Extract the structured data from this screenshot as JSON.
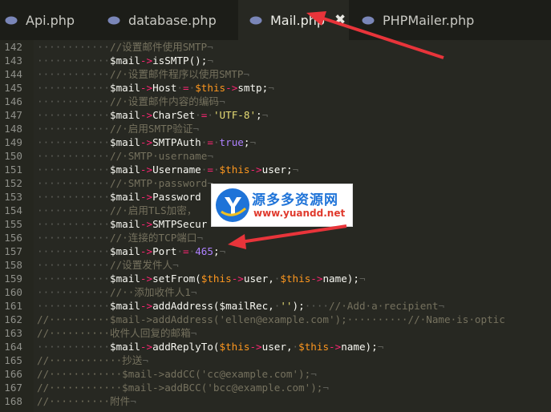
{
  "tabs": [
    {
      "label": "Api.php",
      "active": false
    },
    {
      "label": "database.php",
      "active": false
    },
    {
      "label": "Mail.php",
      "active": true
    },
    {
      "label": "PHPMailer.php",
      "active": false
    }
  ],
  "tab_close_glyph": "✖",
  "watermark": {
    "brand_cn": "源多多资源网",
    "url": "www.yuandd.net"
  },
  "colors": {
    "background": "#272822",
    "comment": "#75715e",
    "operator": "#f92672",
    "string": "#e6db74",
    "number": "#ae81ff",
    "this": "#fd971f",
    "arrow": "#e8343a"
  },
  "lines": [
    {
      "n": "142",
      "indent": "············",
      "parts": [
        [
          "cm",
          "//设置邮件使用SMTP"
        ],
        [
          "dots",
          "¬"
        ]
      ]
    },
    {
      "n": "143",
      "indent": "············",
      "parts": [
        [
          "var",
          "$mail"
        ],
        [
          "op",
          "->"
        ],
        [
          "fn",
          "isSMTP"
        ],
        [
          "var",
          "();"
        ],
        [
          "dots",
          "¬"
        ]
      ]
    },
    {
      "n": "144",
      "indent": "············",
      "parts": [
        [
          "cm",
          "//·设置邮件程序以使用SMTP"
        ],
        [
          "dots",
          "¬"
        ]
      ]
    },
    {
      "n": "145",
      "indent": "············",
      "parts": [
        [
          "var",
          "$mail"
        ],
        [
          "op",
          "->"
        ],
        [
          "prop",
          "Host"
        ],
        [
          "dots",
          "·"
        ],
        [
          "op",
          "="
        ],
        [
          "dots",
          "·"
        ],
        [
          "this",
          "$this"
        ],
        [
          "op",
          "->"
        ],
        [
          "prop",
          "smtp;"
        ],
        [
          "dots",
          "¬"
        ]
      ]
    },
    {
      "n": "146",
      "indent": "············",
      "parts": [
        [
          "cm",
          "//·设置邮件内容的编码"
        ],
        [
          "dots",
          "¬"
        ]
      ]
    },
    {
      "n": "147",
      "indent": "············",
      "parts": [
        [
          "var",
          "$mail"
        ],
        [
          "op",
          "->"
        ],
        [
          "prop",
          "CharSet"
        ],
        [
          "dots",
          "·"
        ],
        [
          "op",
          "="
        ],
        [
          "dots",
          "·"
        ],
        [
          "str",
          "'UTF-8'"
        ],
        [
          "var",
          ";"
        ],
        [
          "dots",
          "¬"
        ]
      ]
    },
    {
      "n": "148",
      "indent": "············",
      "parts": [
        [
          "cm",
          "//·启用SMTP验证"
        ],
        [
          "dots",
          "¬"
        ]
      ]
    },
    {
      "n": "149",
      "indent": "············",
      "parts": [
        [
          "var",
          "$mail"
        ],
        [
          "op",
          "->"
        ],
        [
          "prop",
          "SMTPAuth"
        ],
        [
          "dots",
          "·"
        ],
        [
          "op",
          "="
        ],
        [
          "dots",
          "·"
        ],
        [
          "kw",
          "true"
        ],
        [
          "var",
          ";"
        ],
        [
          "dots",
          "¬"
        ]
      ]
    },
    {
      "n": "150",
      "indent": "············",
      "parts": [
        [
          "cm",
          "//·SMTP·username"
        ],
        [
          "dots",
          "¬"
        ]
      ]
    },
    {
      "n": "151",
      "indent": "············",
      "parts": [
        [
          "var",
          "$mail"
        ],
        [
          "op",
          "->"
        ],
        [
          "prop",
          "Username"
        ],
        [
          "dots",
          "·"
        ],
        [
          "op",
          "="
        ],
        [
          "dots",
          "·"
        ],
        [
          "this",
          "$this"
        ],
        [
          "op",
          "->"
        ],
        [
          "prop",
          "user;"
        ],
        [
          "dots",
          "¬"
        ]
      ]
    },
    {
      "n": "152",
      "indent": "············",
      "parts": [
        [
          "cm",
          "//·SMTP·password"
        ],
        [
          "dots",
          "¬"
        ]
      ]
    },
    {
      "n": "153",
      "indent": "············",
      "parts": [
        [
          "var",
          "$mail"
        ],
        [
          "op",
          "->"
        ],
        [
          "prop",
          "Password"
        ]
      ]
    },
    {
      "n": "154",
      "indent": "············",
      "parts": [
        [
          "cm",
          "//·启用TLS加密，"
        ]
      ]
    },
    {
      "n": "155",
      "indent": "············",
      "parts": [
        [
          "var",
          "$mail"
        ],
        [
          "op",
          "->"
        ],
        [
          "prop",
          "SMTPSecur"
        ]
      ]
    },
    {
      "n": "156",
      "indent": "············",
      "parts": [
        [
          "cm",
          "//·连接的TCP端口"
        ],
        [
          "dots",
          "¬"
        ]
      ]
    },
    {
      "n": "157",
      "indent": "············",
      "parts": [
        [
          "var",
          "$mail"
        ],
        [
          "op",
          "->"
        ],
        [
          "prop",
          "Port"
        ],
        [
          "dots",
          "·"
        ],
        [
          "op",
          "="
        ],
        [
          "dots",
          "·"
        ],
        [
          "num",
          "465"
        ],
        [
          "var",
          ";"
        ],
        [
          "dots",
          "¬"
        ]
      ]
    },
    {
      "n": "158",
      "indent": "············",
      "parts": [
        [
          "cm",
          "//设置发件人"
        ],
        [
          "dots",
          "¬"
        ]
      ]
    },
    {
      "n": "159",
      "indent": "············",
      "parts": [
        [
          "var",
          "$mail"
        ],
        [
          "op",
          "->"
        ],
        [
          "fn",
          "setFrom"
        ],
        [
          "var",
          "("
        ],
        [
          "this",
          "$this"
        ],
        [
          "op",
          "->"
        ],
        [
          "prop",
          "user,"
        ],
        [
          "dots",
          "·"
        ],
        [
          "this",
          "$this"
        ],
        [
          "op",
          "->"
        ],
        [
          "prop",
          "name);"
        ],
        [
          "dots",
          "¬"
        ]
      ]
    },
    {
      "n": "160",
      "indent": "············",
      "parts": [
        [
          "cm",
          "//··添加收件人1"
        ],
        [
          "dots",
          "¬"
        ]
      ]
    },
    {
      "n": "161",
      "indent": "············",
      "parts": [
        [
          "var",
          "$mail"
        ],
        [
          "op",
          "->"
        ],
        [
          "fn",
          "addAddress"
        ],
        [
          "var",
          "($mailRec,"
        ],
        [
          "dots",
          "·"
        ],
        [
          "str",
          "''"
        ],
        [
          "var",
          ");"
        ],
        [
          "dots",
          "····"
        ],
        [
          "cm",
          "//·Add·a·recipient"
        ],
        [
          "dots",
          "¬"
        ]
      ]
    },
    {
      "n": "162",
      "indent": "",
      "parts": [
        [
          "cm",
          "//··········$mail->addAddress('ellen@example.com');··········//·Name·is·optic"
        ]
      ]
    },
    {
      "n": "163",
      "indent": "",
      "parts": [
        [
          "cm",
          "//··········收件人回复的邮箱"
        ],
        [
          "dots",
          "¬"
        ]
      ]
    },
    {
      "n": "164",
      "indent": "············",
      "parts": [
        [
          "var",
          "$mail"
        ],
        [
          "op",
          "->"
        ],
        [
          "fn",
          "addReplyTo"
        ],
        [
          "var",
          "("
        ],
        [
          "this",
          "$this"
        ],
        [
          "op",
          "->"
        ],
        [
          "prop",
          "user,"
        ],
        [
          "dots",
          "·"
        ],
        [
          "this",
          "$this"
        ],
        [
          "op",
          "->"
        ],
        [
          "prop",
          "name);"
        ],
        [
          "dots",
          "¬"
        ]
      ]
    },
    {
      "n": "165",
      "indent": "",
      "parts": [
        [
          "cm",
          "//············抄送"
        ],
        [
          "dots",
          "¬"
        ]
      ]
    },
    {
      "n": "166",
      "indent": "",
      "parts": [
        [
          "cm",
          "//············$mail->addCC('cc@example.com');"
        ],
        [
          "dots",
          "¬"
        ]
      ]
    },
    {
      "n": "167",
      "indent": "",
      "parts": [
        [
          "cm",
          "//············$mail->addBCC('bcc@example.com');"
        ],
        [
          "dots",
          "¬"
        ]
      ]
    },
    {
      "n": "168",
      "indent": "",
      "parts": [
        [
          "cm",
          "//··········附件"
        ],
        [
          "dots",
          "¬"
        ]
      ]
    }
  ]
}
